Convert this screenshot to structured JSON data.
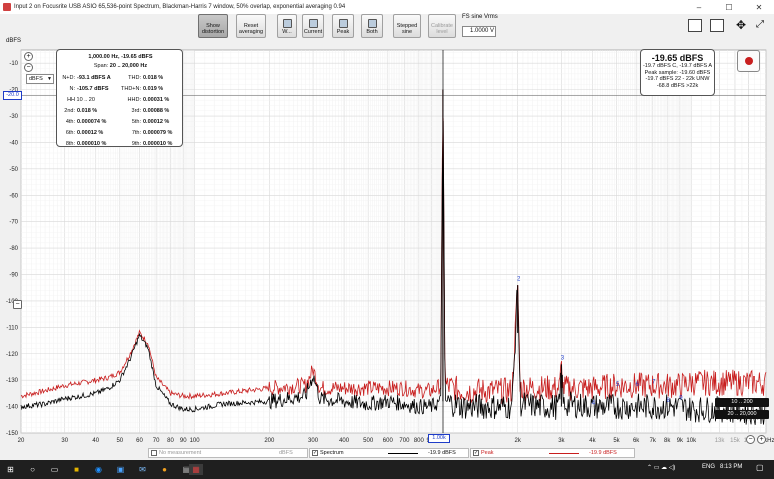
{
  "window": {
    "title": "Input 2 on Focusrite USB ASIO 65,536-point Spectrum, Blackman-Harris 7 window, 50% overlap, exponential averaging 0.94",
    "minimize": "–",
    "maximize": "☐",
    "close": "✕"
  },
  "toolbar": {
    "show_distortion": "Show distortion",
    "reset_averaging": "Reset averaging",
    "w": "W...",
    "current": "Current",
    "peak": "Peak",
    "both": "Both",
    "stepped_sine": "Stepped sine",
    "calibrate_level": "Calibrate level",
    "fs_label": "FS sine Vrms",
    "fs_value": "1.0000 V"
  },
  "plot": {
    "y_unit": "dBFS",
    "unit_select": "dBFS",
    "marker_level": "-20.0",
    "cursor_freq": "1.00k",
    "colors": {
      "grid": "#d8d8d8",
      "spectrum": "#000000",
      "peak": "#c81e1e",
      "cursor": "#1e3cc8"
    }
  },
  "distortion": {
    "header1": "1,000.00 Hz, -19.65 dBFS",
    "header2_label": "Span:",
    "header2_value": "20 .. 20,000 Hz",
    "rows": [
      [
        {
          "l": "N+D:",
          "v": "-93.1 dBFS A"
        },
        {
          "l": "THD:",
          "v": "0.018 %"
        }
      ],
      [
        {
          "l": "N:",
          "v": "-105.7 dBFS"
        },
        {
          "l": "THD+N:",
          "v": "0.019 %"
        }
      ],
      [
        {
          "l": "HH 10 .. 20",
          "v": ""
        },
        {
          "l": "HHD:",
          "v": "0.00031 %"
        }
      ],
      [
        {
          "l": "2nd:",
          "v": "0.018 %"
        },
        {
          "l": "3rd:",
          "v": "0.00088 %"
        }
      ],
      [
        {
          "l": "4th:",
          "v": "0.000074 %"
        },
        {
          "l": "5th:",
          "v": "0.00012 %"
        }
      ],
      [
        {
          "l": "6th:",
          "v": "0.00012 %"
        },
        {
          "l": "7th:",
          "v": "0.000079 %"
        }
      ],
      [
        {
          "l": "8th:",
          "v": "0.000010 %"
        },
        {
          "l": "9th:",
          "v": "0.000010 %"
        }
      ]
    ]
  },
  "level": {
    "big": "-19.65 dBFS",
    "lines": [
      "-19.7 dBFS C, -19.7 dBFS A",
      "Peak sample: -19.60 dBFS",
      "-19.7 dBFS 22 - 22k UNW",
      "-68.8 dBFS >22k"
    ]
  },
  "ranges": {
    "r1": "10 .. 200",
    "r2": "20 .. 20,000"
  },
  "legend": {
    "no_measurement": "No measurement",
    "unit1": "dBFS",
    "spectrum": "Spectrum",
    "spectrum_val": "-19.9 dBFS",
    "peak": "Peak",
    "peak_val": "-19.9 dBFS"
  },
  "taskbar": {
    "language": "ENG",
    "time": "8:13 PM"
  },
  "chart_data": {
    "type": "line",
    "xlabel": "",
    "ylabel": "dBFS",
    "x_scale": "log",
    "xlim": [
      20,
      20000
    ],
    "ylim": [
      -150,
      -5
    ],
    "yticks": [
      -10,
      -20,
      -30,
      -40,
      -50,
      -60,
      -70,
      -80,
      -90,
      -100,
      -110,
      -120,
      -130,
      -140,
      -150
    ],
    "xticks": [
      {
        "v": 20,
        "t": "20"
      },
      {
        "v": 30,
        "t": "30"
      },
      {
        "v": 40,
        "t": "40"
      },
      {
        "v": 50,
        "t": "50"
      },
      {
        "v": 60,
        "t": "60"
      },
      {
        "v": 70,
        "t": "70"
      },
      {
        "v": 80,
        "t": "80"
      },
      {
        "v": 90,
        "t": "90"
      },
      {
        "v": 100,
        "t": "100"
      },
      {
        "v": 200,
        "t": "200"
      },
      {
        "v": 300,
        "t": "300"
      },
      {
        "v": 400,
        "t": "400"
      },
      {
        "v": 500,
        "t": "500"
      },
      {
        "v": 600,
        "t": "600"
      },
      {
        "v": 700,
        "t": "700"
      },
      {
        "v": 800,
        "t": "800"
      },
      {
        "v": 900,
        "t": "900"
      },
      {
        "v": 2000,
        "t": "2k"
      },
      {
        "v": 3000,
        "t": "3k"
      },
      {
        "v": 4000,
        "t": "4k"
      },
      {
        "v": 5000,
        "t": "5k"
      },
      {
        "v": 6000,
        "t": "6k"
      },
      {
        "v": 7000,
        "t": "7k"
      },
      {
        "v": 8000,
        "t": "8k"
      },
      {
        "v": 9000,
        "t": "9k"
      },
      {
        "v": 10000,
        "t": "10k"
      },
      {
        "v": 13000,
        "t": "13k"
      },
      {
        "v": 15000,
        "t": "15k"
      },
      {
        "v": 17000,
        "t": "17k"
      },
      {
        "v": 20000,
        "t": "20kHz"
      }
    ],
    "series": [
      {
        "name": "Spectrum",
        "color": "#000000",
        "points": [
          [
            20,
            -140
          ],
          [
            25,
            -139
          ],
          [
            30,
            -137
          ],
          [
            35,
            -136
          ],
          [
            40,
            -135
          ],
          [
            45,
            -133
          ],
          [
            50,
            -130
          ],
          [
            55,
            -122
          ],
          [
            60,
            -113
          ],
          [
            65,
            -118
          ],
          [
            70,
            -132
          ],
          [
            80,
            -139
          ],
          [
            90,
            -141
          ],
          [
            100,
            -141
          ],
          [
            130,
            -139
          ],
          [
            200,
            -138
          ],
          [
            280,
            -136
          ],
          [
            300,
            -128
          ],
          [
            320,
            -137
          ],
          [
            400,
            -138
          ],
          [
            500,
            -139
          ],
          [
            600,
            -138
          ],
          [
            700,
            -139
          ],
          [
            800,
            -140
          ],
          [
            900,
            -140
          ],
          [
            980,
            -138
          ],
          [
            1000,
            -20
          ],
          [
            1020,
            -138
          ],
          [
            1200,
            -140
          ],
          [
            1500,
            -140
          ],
          [
            1900,
            -140
          ],
          [
            2000,
            -94
          ],
          [
            2050,
            -139
          ],
          [
            2500,
            -140
          ],
          [
            2950,
            -140
          ],
          [
            3000,
            -124
          ],
          [
            3050,
            -139
          ],
          [
            4000,
            -140
          ],
          [
            5000,
            -140
          ],
          [
            6000,
            -140
          ],
          [
            7000,
            -140
          ],
          [
            8000,
            -140
          ],
          [
            9000,
            -140
          ],
          [
            10000,
            -141
          ],
          [
            13000,
            -141
          ],
          [
            17000,
            -142
          ],
          [
            20000,
            -142
          ]
        ]
      },
      {
        "name": "Peak",
        "color": "#c81e1e",
        "points": [
          [
            20,
            -136
          ],
          [
            25,
            -134
          ],
          [
            30,
            -132
          ],
          [
            35,
            -131
          ],
          [
            40,
            -130
          ],
          [
            45,
            -129
          ],
          [
            50,
            -127
          ],
          [
            55,
            -120
          ],
          [
            60,
            -112
          ],
          [
            65,
            -116
          ],
          [
            70,
            -129
          ],
          [
            80,
            -135
          ],
          [
            90,
            -136
          ],
          [
            100,
            -136
          ],
          [
            130,
            -135
          ],
          [
            200,
            -133
          ],
          [
            280,
            -132
          ],
          [
            300,
            -126
          ],
          [
            320,
            -133
          ],
          [
            400,
            -133
          ],
          [
            500,
            -133
          ],
          [
            600,
            -133
          ],
          [
            700,
            -133
          ],
          [
            800,
            -134
          ],
          [
            900,
            -134
          ],
          [
            980,
            -132
          ],
          [
            1000,
            -20
          ],
          [
            1020,
            -132
          ],
          [
            1200,
            -134
          ],
          [
            1500,
            -134
          ],
          [
            1900,
            -134
          ],
          [
            2000,
            -94
          ],
          [
            2050,
            -133
          ],
          [
            2500,
            -133
          ],
          [
            2950,
            -133
          ],
          [
            3000,
            -124
          ],
          [
            3050,
            -133
          ],
          [
            4000,
            -133
          ],
          [
            5000,
            -132
          ],
          [
            6000,
            -132
          ],
          [
            7000,
            -132
          ],
          [
            8000,
            -132
          ],
          [
            9000,
            -132
          ],
          [
            10000,
            -131
          ],
          [
            13000,
            -131
          ],
          [
            17000,
            -131
          ],
          [
            20000,
            -131
          ]
        ]
      }
    ],
    "harmonic_labels": [
      {
        "t": "2",
        "x": 2000,
        "y": -93
      },
      {
        "t": "3",
        "x": 3000,
        "y": -123
      },
      {
        "t": "4",
        "x": 4000,
        "y": -140
      },
      {
        "t": "5",
        "x": 5000,
        "y": -133
      },
      {
        "t": "6",
        "x": 6000,
        "y": -133
      },
      {
        "t": "7",
        "x": 7000,
        "y": -132
      },
      {
        "t": "8",
        "x": 8000,
        "y": -139
      },
      {
        "t": "9",
        "x": 9000,
        "y": -138
      }
    ]
  }
}
